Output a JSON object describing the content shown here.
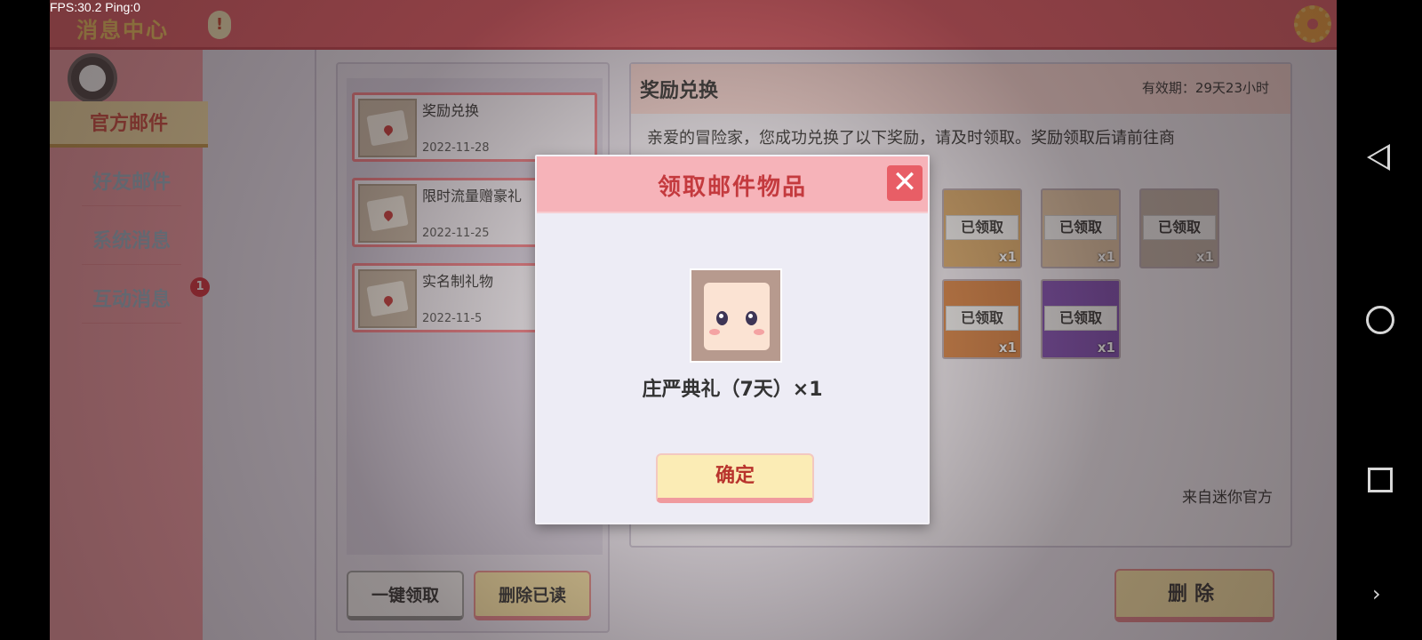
{
  "status": {
    "fps": "FPS:30.2",
    "ping": "Ping:0"
  },
  "header": {
    "title": "消息中心",
    "badge": "!"
  },
  "sidebar": {
    "tabs": [
      {
        "label": "官方邮件",
        "active": true
      },
      {
        "label": "好友邮件",
        "active": false
      },
      {
        "label": "系统消息",
        "active": false
      },
      {
        "label": "互动消息",
        "active": false,
        "badge": "1"
      }
    ]
  },
  "mail_list": {
    "items": [
      {
        "title": "奖励兑换",
        "date": "2022-11-28"
      },
      {
        "title": "限时流量赠豪礼",
        "date": "2022-11-25"
      },
      {
        "title": "实名制礼物",
        "date": "2022-11-5"
      }
    ],
    "claim_all": "一键领取",
    "delete_read": "删除已读"
  },
  "detail": {
    "title": "奖励兑换",
    "validity": "有效期：29天23小时",
    "body": "亲爱的冒险家，您成功兑换了以下奖励，请及时领取。奖励领取后请前往商",
    "sender": "来自迷你官方",
    "rewards": [
      {
        "status": "已领取",
        "qty": "x1"
      },
      {
        "status": "已领取",
        "qty": "x1"
      },
      {
        "status": "已领取",
        "qty": "x1"
      },
      {
        "status": "已领取",
        "qty": "x1"
      },
      {
        "status": "已领取",
        "qty": "x1"
      }
    ],
    "delete": "删除"
  },
  "dialog": {
    "title": "领取邮件物品",
    "close": "✕",
    "item_label": "庄严典礼（7天）×1",
    "confirm": "确定"
  },
  "nav": {
    "more": "›"
  }
}
